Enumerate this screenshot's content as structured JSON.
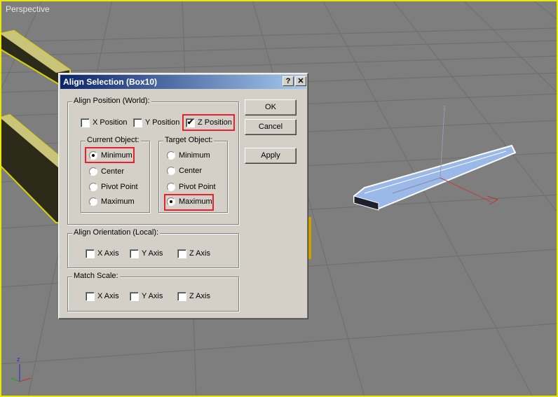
{
  "viewport": {
    "label": "Perspective",
    "border_color": "#e8e800"
  },
  "dialog": {
    "title": "Align Selection (Box10)",
    "help_label": "?",
    "close_label": "✕",
    "align_position": {
      "label": "Align Position (World):",
      "x_label": "X Position",
      "x_checked": false,
      "y_label": "Y Position",
      "y_checked": false,
      "z_label": "Z Position",
      "z_checked": true,
      "check_mark": "✔"
    },
    "current_object": {
      "label": "Current Object:",
      "options": [
        "Minimum",
        "Center",
        "Pivot Point",
        "Maximum"
      ],
      "selected": "Minimum"
    },
    "target_object": {
      "label": "Target Object:",
      "options": [
        "Minimum",
        "Center",
        "Pivot Point",
        "Maximum"
      ],
      "selected": "Maximum"
    },
    "align_orientation": {
      "label": "Align Orientation (Local):",
      "x_label": "X Axis",
      "y_label": "Y Axis",
      "z_label": "Z Axis"
    },
    "match_scale": {
      "label": "Match Scale:",
      "x_label": "X Axis",
      "y_label": "Y Axis",
      "z_label": "Z Axis"
    },
    "buttons": {
      "ok": "OK",
      "cancel": "Cancel",
      "apply": "Apply"
    },
    "highlight_color": "#e8212e"
  }
}
